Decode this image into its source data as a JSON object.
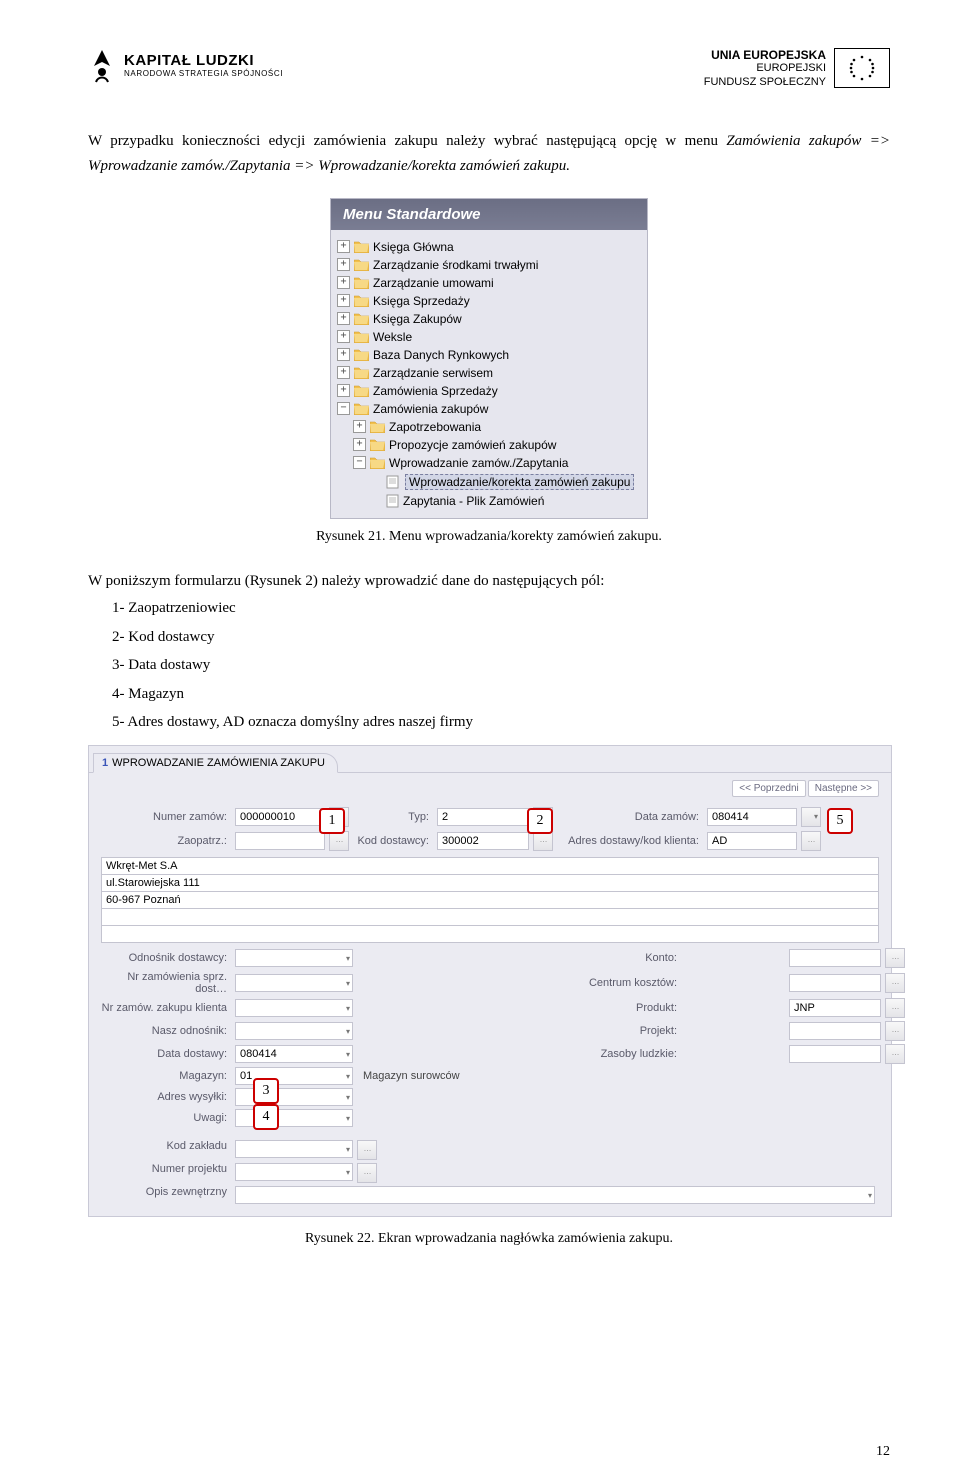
{
  "header": {
    "left_title": "KAPITAŁ LUDZKI",
    "left_sub": "NARODOWA STRATEGIA SPÓJNOŚCI",
    "right_line1": "UNIA EUROPEJSKA",
    "right_line2": "EUROPEJSKI",
    "right_line3": "FUNDUSZ SPOŁECZNY"
  },
  "para1_a": "W przypadku konieczności edycji zamówienia zakupu należy wybrać następującą opcję w menu ",
  "para1_b": "Zamówienia zakupów => Wprowadzanie zamów./Zapytania => Wprowadzanie/korekta zamówień zakupu.",
  "caption1": "Rysunek 21. Menu wprowadzania/korekty zamówień zakupu.",
  "para2": "W poniższym formularzu (Rysunek 2) należy wprowadzić dane do następujących pól:",
  "list": [
    "1-   Zaopatrzeniowiec",
    "2-   Kod dostawcy",
    "3-   Data dostawy",
    "4-   Magazyn",
    "5-   Adres dostawy, AD oznacza domyślny adres naszej firmy"
  ],
  "caption2": "Rysunek 22. Ekran wprowadzania nagłówka zamówienia zakupu.",
  "pagenum": "12",
  "menu": {
    "title": "Menu Standardowe",
    "items": [
      {
        "t": "plus",
        "ind": 0,
        "ic": "folder",
        "label": "Księga Główna"
      },
      {
        "t": "plus",
        "ind": 0,
        "ic": "folder",
        "label": "Zarządzanie środkami trwałymi"
      },
      {
        "t": "plus",
        "ind": 0,
        "ic": "folder",
        "label": "Zarządzanie umowami"
      },
      {
        "t": "plus",
        "ind": 0,
        "ic": "folder",
        "label": "Księga Sprzedaży"
      },
      {
        "t": "plus",
        "ind": 0,
        "ic": "folder",
        "label": "Księga Zakupów"
      },
      {
        "t": "plus",
        "ind": 0,
        "ic": "folder",
        "label": "Weksle"
      },
      {
        "t": "plus",
        "ind": 0,
        "ic": "folder",
        "label": "Baza Danych Rynkowych"
      },
      {
        "t": "plus",
        "ind": 0,
        "ic": "folder",
        "label": "Zarządzanie serwisem"
      },
      {
        "t": "plus",
        "ind": 0,
        "ic": "folder",
        "label": "Zamówienia Sprzedaży"
      },
      {
        "t": "minus",
        "ind": 0,
        "ic": "folder",
        "label": "Zamówienia zakupów"
      },
      {
        "t": "plus",
        "ind": 1,
        "ic": "folder",
        "label": "Zapotrzebowania"
      },
      {
        "t": "plus",
        "ind": 1,
        "ic": "folder",
        "label": "Propozycje zamówień zakupów"
      },
      {
        "t": "minus",
        "ind": 1,
        "ic": "folder",
        "label": "Wprowadzanie zamów./Zapytania"
      },
      {
        "t": "none",
        "ind": 2,
        "ic": "doc",
        "label": "Wprowadzanie/korekta zamówień zakupu",
        "sel": true
      },
      {
        "t": "none",
        "ind": 2,
        "ic": "doc",
        "label": "Zapytania - Plik Zamówień"
      }
    ]
  },
  "form": {
    "tab_num": "1",
    "tab_label": "WPROWADZANIE ZAMÓWIENIA ZAKUPU",
    "nav_prev": "<< Poprzedni",
    "nav_next": "Następne >>",
    "row1": {
      "l1": "Numer zamów:",
      "v1": "000000010",
      "l2": "Typ:",
      "v2": "2",
      "l3": "Data zamów:",
      "v3": "080414"
    },
    "row2": {
      "l1": "Zaopatrz.:",
      "v1": "",
      "l2": "Kod dostawcy:",
      "v2": "300002",
      "l3": "Adres dostawy/kod klienta:",
      "v3": "AD"
    },
    "supplier": [
      "Wkręt-Met S.A",
      "ul.Starowiejska 111",
      "60-967 Poznań",
      "",
      ""
    ],
    "bottom": [
      {
        "l": "Odnośnik dostawcy:",
        "v": "",
        "r": "Konto:",
        "rv": ""
      },
      {
        "l": "Nr zamówienia sprz. dost…",
        "v": "",
        "r": "Centrum kosztów:",
        "rv": ""
      },
      {
        "l": "Nr zamów. zakupu klienta",
        "v": "",
        "r": "Produkt:",
        "rv": "JNP"
      },
      {
        "l": "Nasz odnośnik:",
        "v": "",
        "r": "Projekt:",
        "rv": ""
      },
      {
        "l": "Data dostawy:",
        "v": "080414",
        "r": "Zasoby ludzkie:",
        "rv": ""
      },
      {
        "l": "Magazyn:",
        "v": "01",
        "extra": "Magazyn surowców"
      },
      {
        "l": "Adres wysyłki:",
        "v": ""
      },
      {
        "l": "Uwagi:",
        "v": ""
      }
    ],
    "tail": [
      {
        "l": "Kod zakładu",
        "v": ""
      },
      {
        "l": "Numer projektu",
        "v": ""
      },
      {
        "l": "Opis zewnętrzny",
        "v": "",
        "full": true
      }
    ],
    "callouts": {
      "c1": "1",
      "c2": "2",
      "c5": "5",
      "c3": "3",
      "c4": "4"
    }
  }
}
